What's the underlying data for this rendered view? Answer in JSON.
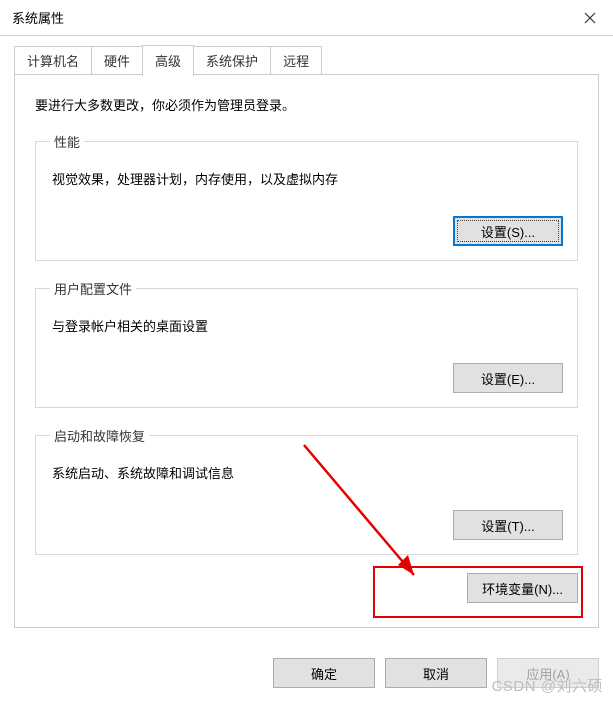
{
  "window": {
    "title": "系统属性"
  },
  "tabs": [
    {
      "label": "计算机名"
    },
    {
      "label": "硬件"
    },
    {
      "label": "高级"
    },
    {
      "label": "系统保护"
    },
    {
      "label": "远程"
    }
  ],
  "advanced": {
    "intro": "要进行大多数更改，你必须作为管理员登录。",
    "performance": {
      "legend": "性能",
      "desc": "视觉效果，处理器计划，内存使用，以及虚拟内存",
      "button": "设置(S)..."
    },
    "user_profiles": {
      "legend": "用户配置文件",
      "desc": "与登录帐户相关的桌面设置",
      "button": "设置(E)..."
    },
    "startup": {
      "legend": "启动和故障恢复",
      "desc": "系统启动、系统故障和调试信息",
      "button": "设置(T)..."
    },
    "env_vars_button": "环境变量(N)..."
  },
  "footer": {
    "ok": "确定",
    "cancel": "取消",
    "apply": "应用(A)"
  },
  "watermark": "CSDN @刘六硕"
}
